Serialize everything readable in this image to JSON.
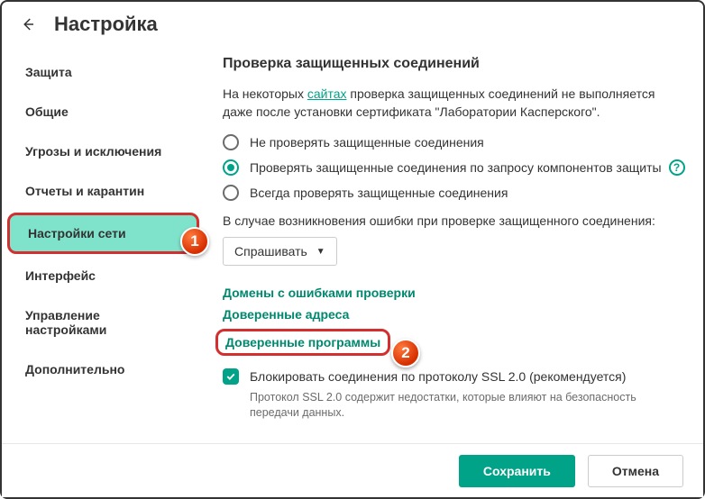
{
  "header": {
    "title": "Настройка"
  },
  "sidebar": {
    "items": [
      {
        "label": "Защита"
      },
      {
        "label": "Общие"
      },
      {
        "label": "Угрозы и исключения"
      },
      {
        "label": "Отчеты и карантин"
      },
      {
        "label": "Настройки сети",
        "active": true
      },
      {
        "label": "Интерфейс"
      },
      {
        "label": "Управление настройками"
      },
      {
        "label": "Дополнительно"
      }
    ]
  },
  "main": {
    "section_title": "Проверка защищенных соединений",
    "desc_pre": "На некоторых ",
    "desc_link": "сайтах",
    "desc_post": " проверка защищенных соединений не выполняется даже после установки сертификата \"Лаборатории Касперского\".",
    "radios": [
      {
        "label": "Не проверять защищенные соединения",
        "checked": false
      },
      {
        "label": "Проверять защищенные соединения по запросу компонентов защиты",
        "checked": true,
        "help": true
      },
      {
        "label": "Всегда проверять защищенные соединения",
        "checked": false
      }
    ],
    "error_intro": "В случае возникновения ошибки при проверке защищенного соединения:",
    "error_select": "Спрашивать",
    "links": [
      {
        "label": "Домены с ошибками проверки"
      },
      {
        "label": "Доверенные адреса"
      },
      {
        "label": "Доверенные программы",
        "highlighted": true
      }
    ],
    "ssl_block": {
      "label": "Блокировать соединения по протоколу SSL 2.0 (рекомендуется)",
      "sub": "Протокол SSL 2.0 содержит недостатки, которые влияют на безопасность передачи данных."
    }
  },
  "footer": {
    "save": "Сохранить",
    "cancel": "Отмена"
  },
  "callouts": {
    "one": "1",
    "two": "2"
  }
}
